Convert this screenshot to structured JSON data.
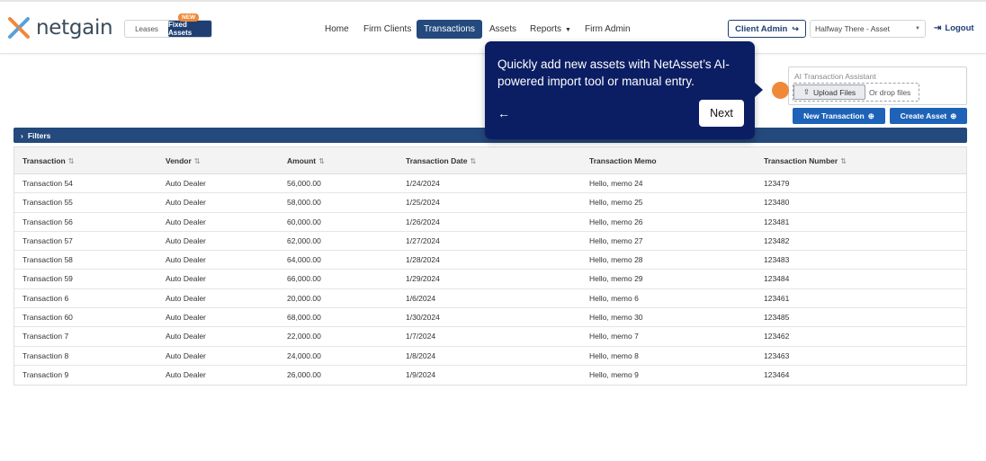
{
  "brand": {
    "logo_text": "netgain",
    "accent": "#1f3f73",
    "orange": "#f0883a"
  },
  "module_switch": {
    "leases": "Leases",
    "fixed_assets": "Fixed Assets",
    "badge": "NEW"
  },
  "nav": {
    "home": "Home",
    "firm_clients": "Firm Clients",
    "transactions": "Transactions",
    "assets": "Assets",
    "reports": "Reports",
    "firm_admin": "Firm Admin"
  },
  "header_right": {
    "client_admin": "Client Admin",
    "client_select": "Halfway There - Asset",
    "logout": "Logout"
  },
  "ai_assistant": {
    "title": "AI Transaction Assistant",
    "upload_label": "Upload Files",
    "drop_text": "Or drop files"
  },
  "actions": {
    "new_transaction": "New Transaction",
    "create_asset": "Create Asset"
  },
  "filters_label": "Filters",
  "table": {
    "columns": [
      "Transaction",
      "Vendor",
      "Amount",
      "Transaction Date",
      "Transaction Memo",
      "Transaction Number"
    ],
    "rows": [
      [
        "Transaction 54",
        "Auto Dealer",
        "56,000.00",
        "1/24/2024",
        "Hello, memo 24",
        "123479"
      ],
      [
        "Transaction 55",
        "Auto Dealer",
        "58,000.00",
        "1/25/2024",
        "Hello, memo 25",
        "123480"
      ],
      [
        "Transaction 56",
        "Auto Dealer",
        "60,000.00",
        "1/26/2024",
        "Hello, memo 26",
        "123481"
      ],
      [
        "Transaction 57",
        "Auto Dealer",
        "62,000.00",
        "1/27/2024",
        "Hello, memo 27",
        "123482"
      ],
      [
        "Transaction 58",
        "Auto Dealer",
        "64,000.00",
        "1/28/2024",
        "Hello, memo 28",
        "123483"
      ],
      [
        "Transaction 59",
        "Auto Dealer",
        "66,000.00",
        "1/29/2024",
        "Hello, memo 29",
        "123484"
      ],
      [
        "Transaction 6",
        "Auto Dealer",
        "20,000.00",
        "1/6/2024",
        "Hello, memo 6",
        "123461"
      ],
      [
        "Transaction 60",
        "Auto Dealer",
        "68,000.00",
        "1/30/2024",
        "Hello, memo 30",
        "123485"
      ],
      [
        "Transaction 7",
        "Auto Dealer",
        "22,000.00",
        "1/7/2024",
        "Hello, memo 7",
        "123462"
      ],
      [
        "Transaction 8",
        "Auto Dealer",
        "24,000.00",
        "1/8/2024",
        "Hello, memo 8",
        "123463"
      ],
      [
        "Transaction 9",
        "Auto Dealer",
        "26,000.00",
        "1/9/2024",
        "Hello, memo 9",
        "123464"
      ]
    ]
  },
  "tour": {
    "text": "Quickly add new assets with NetAsset’s AI-powered import tool or manual entry.",
    "back": "←",
    "next": "Next"
  }
}
